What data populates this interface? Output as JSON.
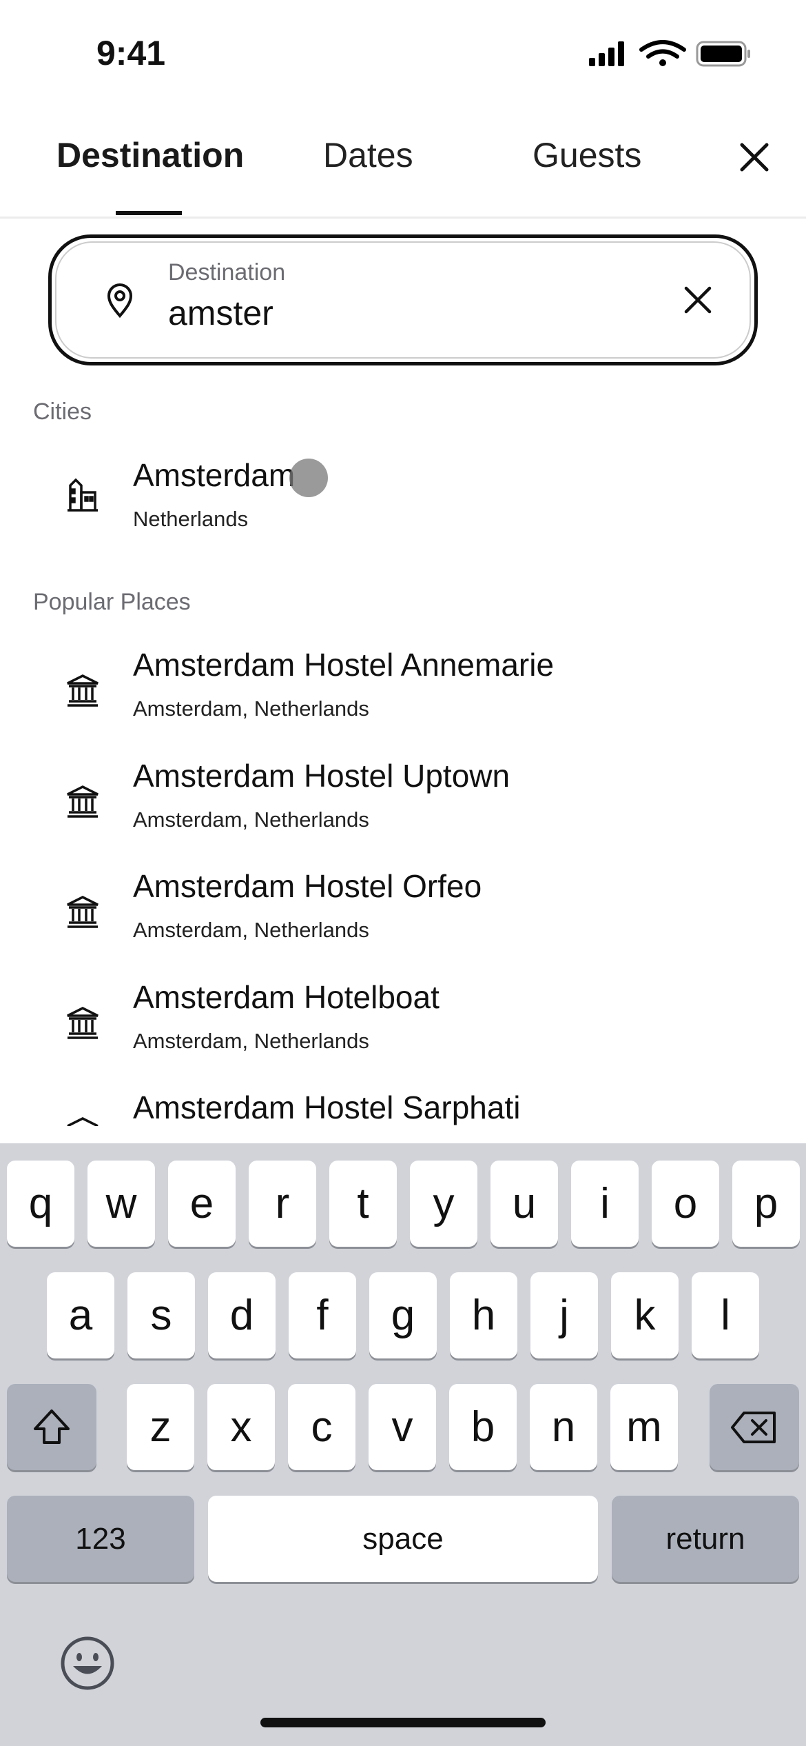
{
  "status_bar": {
    "time": "9:41"
  },
  "tabs": [
    {
      "label": "Destination",
      "active": true
    },
    {
      "label": "Dates"
    },
    {
      "label": "Guests"
    }
  ],
  "search": {
    "label": "Destination",
    "value": "amster"
  },
  "sections": {
    "cities": "Cities",
    "popular": "Popular Places"
  },
  "cities": [
    {
      "name": "Amsterdam",
      "country": "Netherlands",
      "icon": "city-buildings-icon"
    }
  ],
  "places": [
    {
      "name": "Amsterdam Hostel Annemarie",
      "location": "Amsterdam, Netherlands"
    },
    {
      "name": "Amsterdam Hostel Uptown",
      "location": "Amsterdam, Netherlands"
    },
    {
      "name": "Amsterdam Hostel Orfeo",
      "location": "Amsterdam, Netherlands"
    },
    {
      "name": "Amsterdam Hotelboat",
      "location": "Amsterdam, Netherlands"
    },
    {
      "name": "Amsterdam Hostel Sarphati",
      "location": ""
    }
  ],
  "keyboard": {
    "row1": [
      "q",
      "w",
      "e",
      "r",
      "t",
      "y",
      "u",
      "i",
      "o",
      "p"
    ],
    "row2": [
      "a",
      "s",
      "d",
      "f",
      "g",
      "h",
      "j",
      "k",
      "l"
    ],
    "row3": [
      "z",
      "x",
      "c",
      "v",
      "b",
      "n",
      "m"
    ],
    "numbers": "123",
    "space": "space",
    "return": "return"
  },
  "colors": {
    "keyboard_bg": "#d1d3d9",
    "special_key": "#abb0bb"
  }
}
